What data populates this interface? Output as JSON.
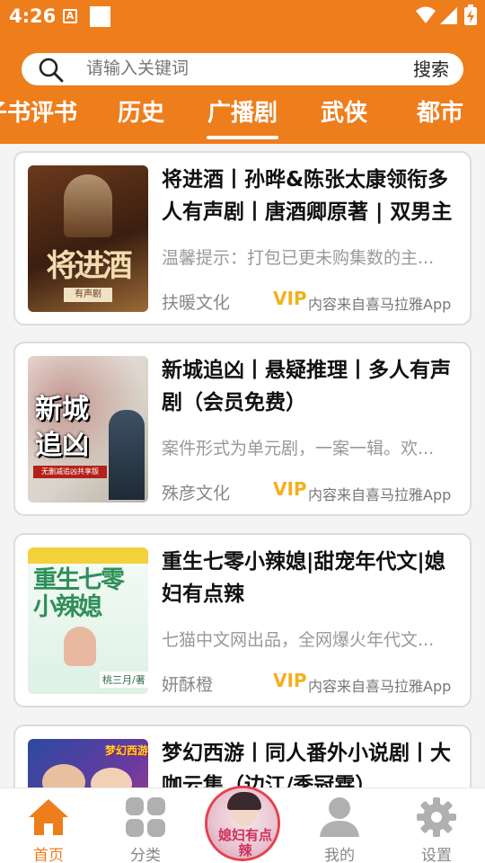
{
  "status": {
    "time": "4:26",
    "notif_letter": "A"
  },
  "search": {
    "placeholder": "请输入关键词",
    "button_label": "搜索"
  },
  "tabs": [
    "子书评书",
    "历史",
    "广播剧",
    "武侠",
    "都市"
  ],
  "active_tab": "广播剧",
  "items": [
    {
      "title": "将进酒丨孙晔&陈张太康领衔多人有声剧丨唐酒卿原著 | 双男主",
      "desc": "温馨提示：打包已更未购集数的主...",
      "author": "扶暖文化",
      "vip": "VIP",
      "source": "内容来自喜马拉雅App",
      "cover_text": "将进酒",
      "cover_sub": "有声剧",
      "cover_colors": [
        "#4a2a14",
        "#b8844a"
      ]
    },
    {
      "title": "新城追凶丨悬疑推理丨多人有声剧（会员免费）",
      "desc": "案件形式为单元剧，一案一辑。欢...",
      "author": "殊彦文化",
      "vip": "VIP",
      "source": "内容来自喜马拉雅App",
      "cover_text": "新城追凶",
      "cover_sub": "无删减追凶共享版",
      "cover_colors": [
        "#e9e5df",
        "#7a1c14"
      ]
    },
    {
      "title": "重生七零小辣媳|甜宠年代文|媳妇有点辣",
      "desc": "七猫中文网出品，全网爆火年代文...",
      "author": "妍酥橙",
      "vip": "VIP",
      "source": "内容来自喜马拉雅App",
      "cover_text": "重生七零小辣媳",
      "cover_sub": "桃三月/著",
      "cover_colors": [
        "#e4f3ea",
        "#3e9f6c"
      ]
    },
    {
      "title": "梦幻西游丨同人番外小说剧丨大咖云集（边江/季冠霖）",
      "desc": "",
      "author": "",
      "vip": "",
      "source": "",
      "cover_text": "梦幻西游",
      "cover_sub": "",
      "cover_colors": [
        "#3050a8",
        "#d64a6a"
      ]
    }
  ],
  "nav": [
    {
      "label": "首页",
      "icon": "home-icon",
      "active": true
    },
    {
      "label": "分类",
      "icon": "category-icon",
      "active": false
    },
    {
      "label": "",
      "icon": "now-playing-disc",
      "active": false
    },
    {
      "label": "我的",
      "icon": "profile-icon",
      "active": false
    },
    {
      "label": "设置",
      "icon": "settings-icon",
      "active": false
    }
  ],
  "center_disc_text": "媳妇有点辣",
  "colors": {
    "brand": "#ee7d1c",
    "vip": "#f2b01e"
  }
}
